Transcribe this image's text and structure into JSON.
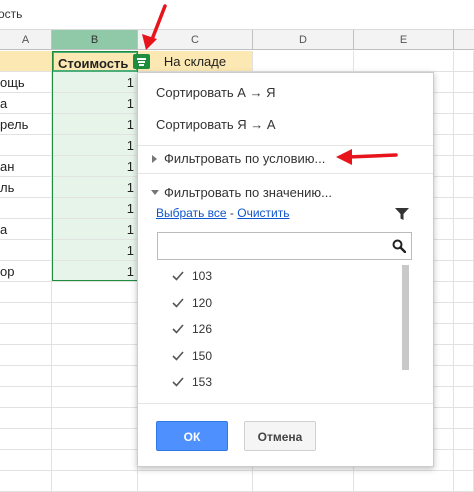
{
  "formula_bar": {
    "text": "ость"
  },
  "columns": [
    {
      "letter": "A"
    },
    {
      "letter": "B"
    },
    {
      "letter": "C"
    },
    {
      "letter": "D"
    },
    {
      "letter": "E"
    }
  ],
  "header_row": {
    "b": "Стоимость",
    "c": "На складе"
  },
  "col_a_values": [
    "ощь",
    "а",
    "рель",
    "",
    "ан",
    "ль",
    "",
    "а",
    "",
    "ор"
  ],
  "col_b_values": [
    "1",
    "1",
    "1",
    "1",
    "1",
    "1",
    "1",
    "1",
    "1",
    "1"
  ],
  "dropdown": {
    "sort_asc": "Сортировать А → Я",
    "sort_desc": "Сортировать Я → А",
    "filter_by_condition": "Фильтровать по условию...",
    "filter_by_value": "Фильтровать по значению...",
    "select_all": "Выбрать все",
    "link_separator": " - ",
    "clear": "Очистить",
    "search": {
      "value": "",
      "placeholder": ""
    },
    "values": [
      {
        "label": "103",
        "checked": true
      },
      {
        "label": "120",
        "checked": true
      },
      {
        "label": "126",
        "checked": true
      },
      {
        "label": "150",
        "checked": true
      },
      {
        "label": "153",
        "checked": true
      }
    ],
    "ok": "ОК",
    "cancel": "Отмена"
  },
  "colors": {
    "accent_green": "#1e8e3e",
    "header_fill": "#fce8b2",
    "ok_button": "#4d90fe",
    "annotation_arrow": "#e8141c",
    "link": "#1155cc"
  },
  "icons": [
    "filter-button-icon",
    "funnel-icon",
    "search-icon",
    "checkmark-icon",
    "triangle-right-icon",
    "triangle-down-icon"
  ]
}
